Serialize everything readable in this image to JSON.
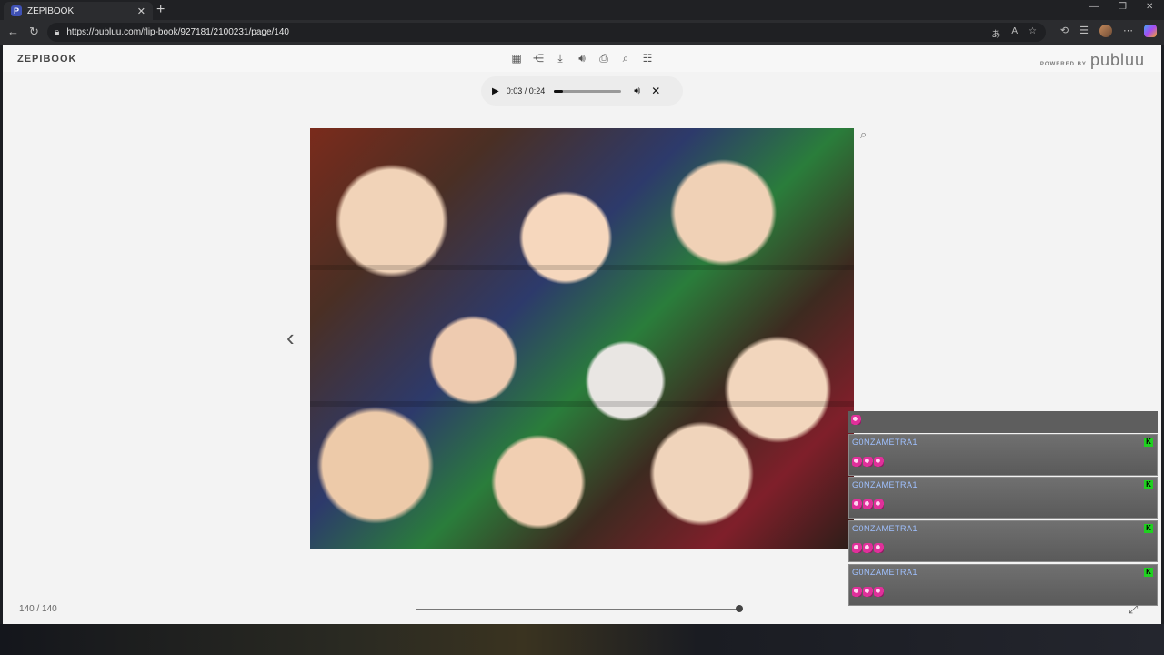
{
  "browser": {
    "tab_title": "ZEPIBOOK",
    "tab_favicon": "P",
    "url": "https://publuu.com/flip-book/927181/2100231/page/140"
  },
  "viewer": {
    "brand": "ZEPIBOOK",
    "powered_by": "POWERED BY",
    "powered_logo": "publuu",
    "toolbar_icons": [
      "grid-icon",
      "share-icon",
      "download-icon",
      "sound-icon",
      "print-icon",
      "search-icon",
      "toc-icon"
    ],
    "audio": {
      "time": "0:03 / 0:24",
      "progress": 0.13
    },
    "page_count": "140 / 140",
    "slider_position": 1.0
  },
  "chat": {
    "messages": [
      {
        "name": "",
        "emotes": 1,
        "badge": false
      },
      {
        "name": "G0NZAMETRA1",
        "emotes": 3,
        "badge": true
      },
      {
        "name": "G0NZAMETRA1",
        "emotes": 3,
        "badge": true
      },
      {
        "name": "G0NZAMETRA1",
        "emotes": 3,
        "badge": true
      },
      {
        "name": "G0NZAMETRA1",
        "emotes": 3,
        "badge": true
      }
    ]
  }
}
